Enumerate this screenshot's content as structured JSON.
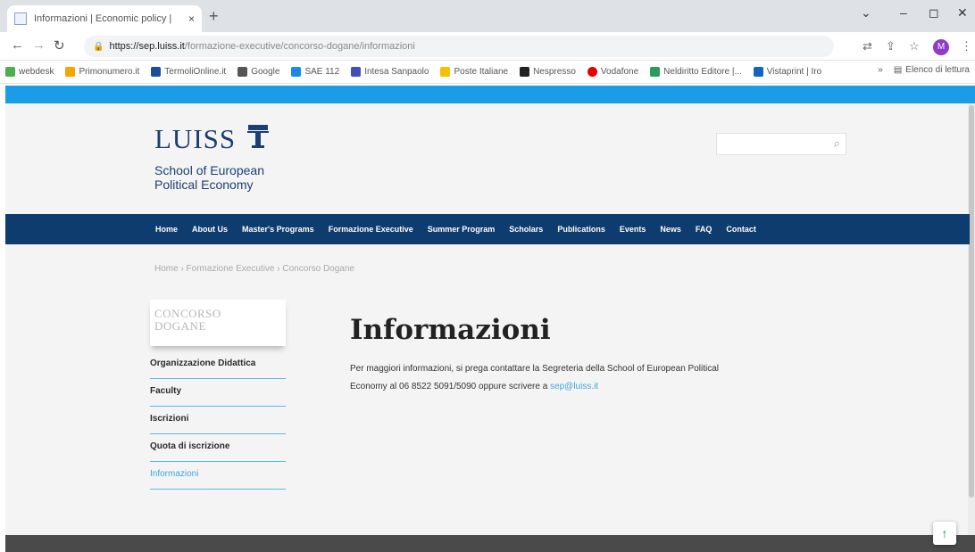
{
  "browser": {
    "tab_title": "Informazioni | Economic policy |",
    "tab_close": "×",
    "new_tab": "+",
    "window_controls": {
      "chevron": "⌄",
      "minimize": "–",
      "maximize": "◻",
      "close": "✕"
    },
    "url_domain": "https://sep.luiss.it",
    "url_path": "/formazione-executive/concorso-dogane/informazioni",
    "profile_initial": "M",
    "bookmarks": [
      {
        "label": "webdesk",
        "color": "#4caf50"
      },
      {
        "label": "Primonumero.it",
        "color": "#f7a300"
      },
      {
        "label": "TermoliOnline.it",
        "color": "#1b4f9c"
      },
      {
        "label": "Google",
        "color": "#555555"
      },
      {
        "label": "SAE 112",
        "color": "#1e88e5"
      },
      {
        "label": "Intesa Sanpaolo",
        "color": "#3f51b5"
      },
      {
        "label": "Poste Italiane",
        "color": "#f2c200"
      },
      {
        "label": "Nespresso",
        "color": "#222222"
      },
      {
        "label": "Vodafone",
        "color": "#e60000"
      },
      {
        "label": "Neldiritto Editore |...",
        "color": "#2a9d5a"
      },
      {
        "label": "Vistaprint | Iro",
        "color": "#1565c0"
      }
    ],
    "reading_list": "Elenco di lettura",
    "bookmarks_more": "»"
  },
  "site": {
    "accent_color": "#1b9ce6",
    "nav_color": "#0e3c6f",
    "logo_text": "LUISS",
    "logo_sub_line1": "School of European",
    "logo_sub_line2": "Political Economy",
    "search_placeholder": "",
    "nav": [
      "Home",
      "About Us",
      "Master's Programs",
      "Formazione Executive",
      "Summer Program",
      "Scholars",
      "Publications",
      "Events",
      "News",
      "FAQ",
      "Contact"
    ],
    "breadcrumb": "Home › Formazione Executive › Concorso Dogane",
    "sidebar_title_line1": "CONCORSO",
    "sidebar_title_line2": "DOGANE",
    "sidebar_items": [
      "Organizzazione Didattica",
      "Faculty",
      "Iscrizioni",
      "Quota di iscrizione",
      "Informazioni"
    ],
    "heading": "Informazioni",
    "body_line1": "Per maggiori informazioni, si prega contattare la Segreteria della School of European Political",
    "body_line2": "Economy al 06 8522 5091/5090 oppure scrivere a ",
    "body_email": "sep@luiss.it",
    "totop_icon": "↑"
  }
}
